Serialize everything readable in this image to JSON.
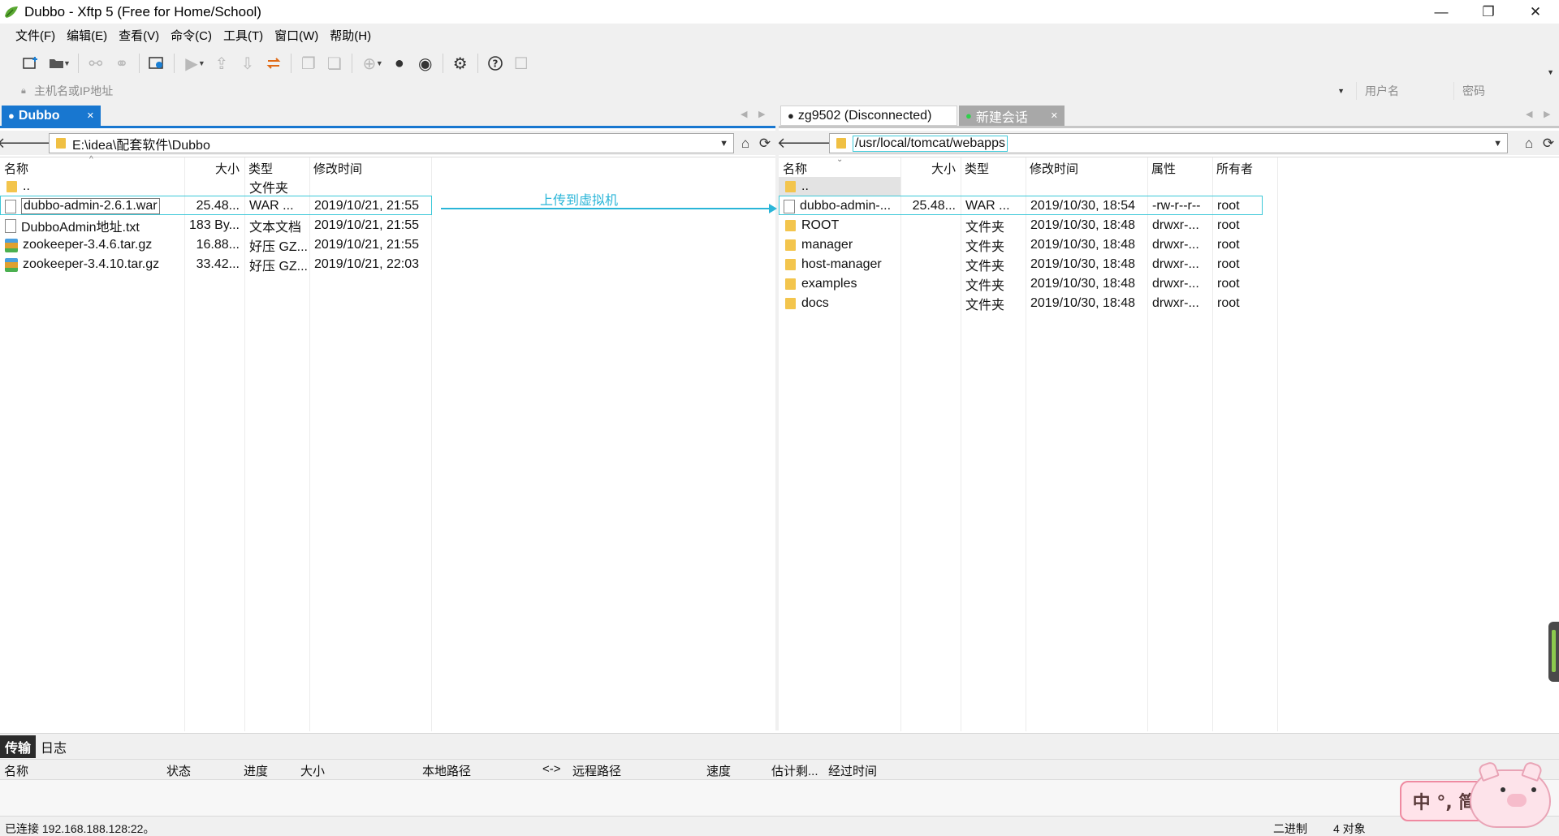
{
  "window": {
    "title": "Dubbo - Xftp 5 (Free for Home/School)",
    "minimize": "—",
    "restore": "❐",
    "close": "✕"
  },
  "menu": [
    "文件(F)",
    "编辑(E)",
    "查看(V)",
    "命令(C)",
    "工具(T)",
    "窗口(W)",
    "帮助(H)"
  ],
  "address": {
    "host_placeholder": "主机名或IP地址",
    "user_placeholder": "用户名",
    "password_placeholder": "密码"
  },
  "left_pane": {
    "tab_label": "Dubbo",
    "path": "E:\\idea\\配套软件\\Dubbo",
    "columns": [
      "名称",
      "大小",
      "类型",
      "修改时间"
    ],
    "rows": [
      {
        "name": "..",
        "size": "",
        "type": "文件夹",
        "modified": "",
        "icon": "folder-icon"
      },
      {
        "name": "dubbo-admin-2.6.1.war",
        "size": "25.48...",
        "type": "WAR ...",
        "modified": "2019/10/21, 21:55",
        "icon": "file-icon"
      },
      {
        "name": "DubboAdmin地址.txt",
        "size": "183 By...",
        "type": "文本文档",
        "modified": "2019/10/21, 21:55",
        "icon": "text-file-icon"
      },
      {
        "name": "zookeeper-3.4.6.tar.gz",
        "size": "16.88...",
        "type": "好压 GZ...",
        "modified": "2019/10/21, 21:55",
        "icon": "archive-icon"
      },
      {
        "name": "zookeeper-3.4.10.tar.gz",
        "size": "33.42...",
        "type": "好压 GZ...",
        "modified": "2019/10/21, 22:03",
        "icon": "archive-icon"
      }
    ]
  },
  "right_pane": {
    "tab1_label": "zg9502 (Disconnected)",
    "tab2_label": "新建会话",
    "path": "/usr/local/tomcat/webapps",
    "columns": [
      "名称",
      "大小",
      "类型",
      "修改时间",
      "属性",
      "所有者"
    ],
    "rows": [
      {
        "name": "..",
        "size": "",
        "type": "",
        "modified": "",
        "attr": "",
        "owner": "",
        "icon": "folder-icon"
      },
      {
        "name": "dubbo-admin-...",
        "size": "25.48...",
        "type": "WAR ...",
        "modified": "2019/10/30, 18:54",
        "attr": "-rw-r--r--",
        "owner": "root",
        "icon": "file-icon"
      },
      {
        "name": "ROOT",
        "size": "",
        "type": "文件夹",
        "modified": "2019/10/30, 18:48",
        "attr": "drwxr-...",
        "owner": "root",
        "icon": "folder-icon"
      },
      {
        "name": "manager",
        "size": "",
        "type": "文件夹",
        "modified": "2019/10/30, 18:48",
        "attr": "drwxr-...",
        "owner": "root",
        "icon": "folder-icon"
      },
      {
        "name": "host-manager",
        "size": "",
        "type": "文件夹",
        "modified": "2019/10/30, 18:48",
        "attr": "drwxr-...",
        "owner": "root",
        "icon": "folder-icon"
      },
      {
        "name": "examples",
        "size": "",
        "type": "文件夹",
        "modified": "2019/10/30, 18:48",
        "attr": "drwxr-...",
        "owner": "root",
        "icon": "folder-icon"
      },
      {
        "name": "docs",
        "size": "",
        "type": "文件夹",
        "modified": "2019/10/30, 18:48",
        "attr": "drwxr-...",
        "owner": "root",
        "icon": "folder-icon"
      }
    ]
  },
  "annotation": "上传到虚拟机",
  "transfer": {
    "tabs": [
      "传输",
      "日志"
    ],
    "columns": [
      "名称",
      "状态",
      "进度",
      "大小",
      "本地路径",
      "<->",
      "远程路径",
      "速度",
      "估计剩...",
      "经过时间"
    ]
  },
  "status": {
    "connection": "已连接 192.168.188.128:22。",
    "mode": "二进制",
    "objects": "4 对象"
  },
  "ime": {
    "label": "中 °, 简"
  },
  "colors": {
    "accent": "#1877d0",
    "annotation": "#2ab5d8",
    "folder": "#f3c54d"
  }
}
